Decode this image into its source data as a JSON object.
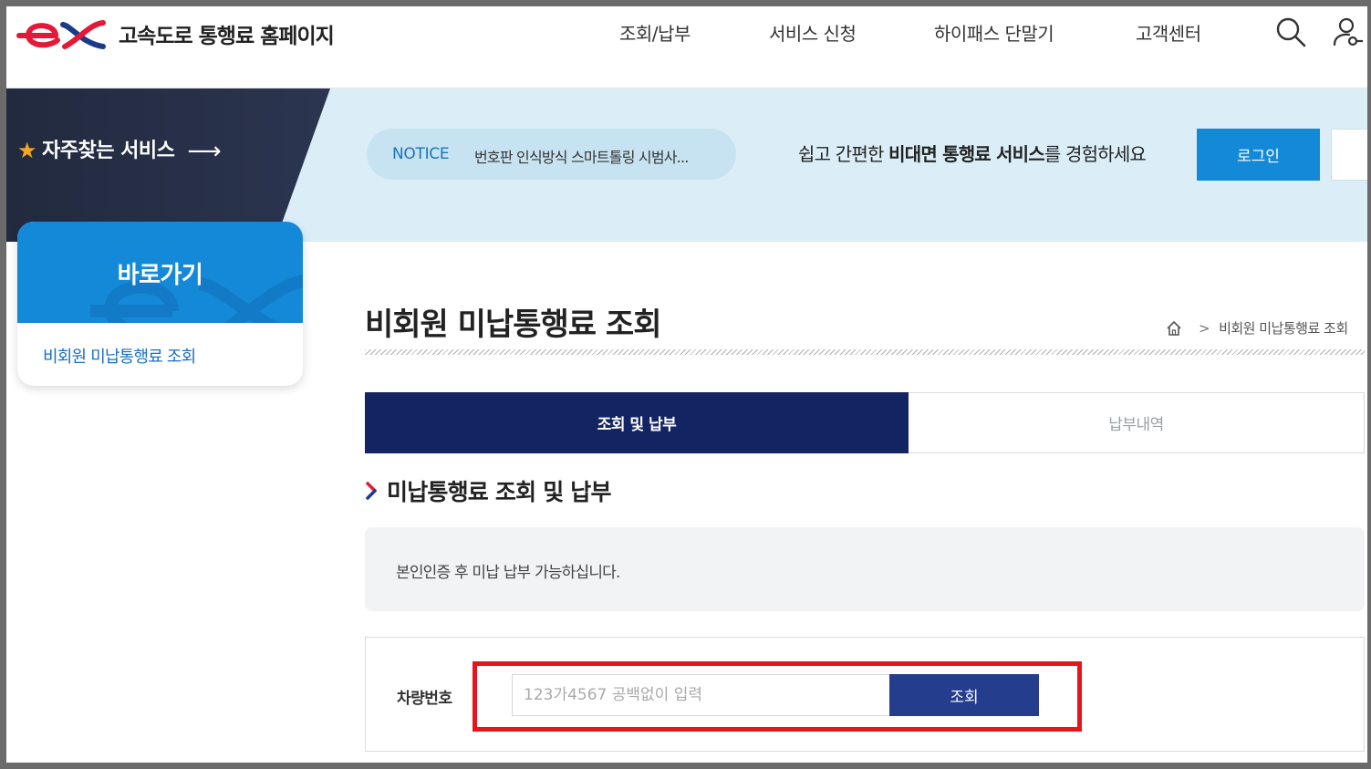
{
  "header": {
    "site_title": "고속도로 통행료 홈페이지",
    "nav": [
      "조회/납부",
      "서비스 신청",
      "하이패스 단말기",
      "고객센터"
    ],
    "icons": [
      "search-icon",
      "user-icon"
    ]
  },
  "banner": {
    "favorites_label": "자주찾는 서비스",
    "notice_label": "NOTICE",
    "notice_text": "번호판 인식방식 스마트톨링 시범사...",
    "promo_prefix": "쉽고 간편한 ",
    "promo_bold": "비대면 통행료 서비스",
    "promo_suffix": "를 경험하세요",
    "login_label": "로그인"
  },
  "shortcut": {
    "title": "바로가기",
    "link": "비회원 미납통행료 조회"
  },
  "page": {
    "title": "비회원 미납통행료 조회",
    "breadcrumb": "비회원 미납통행료 조회"
  },
  "tabs": {
    "active": "조회 및 납부",
    "inactive": "납부내역"
  },
  "section": {
    "title": "미납통행료 조회 및 납부",
    "info": "본인인증 후 미납 납부 가능하십니다."
  },
  "form": {
    "label": "차량번호",
    "placeholder": "123가4567 공백없이 입력",
    "button": "조회"
  },
  "colors": {
    "primary_blue": "#1489d8",
    "navy": "#132463",
    "button_blue": "#243d8d",
    "highlight_red": "#e8141b",
    "logo_red": "#e31937"
  }
}
